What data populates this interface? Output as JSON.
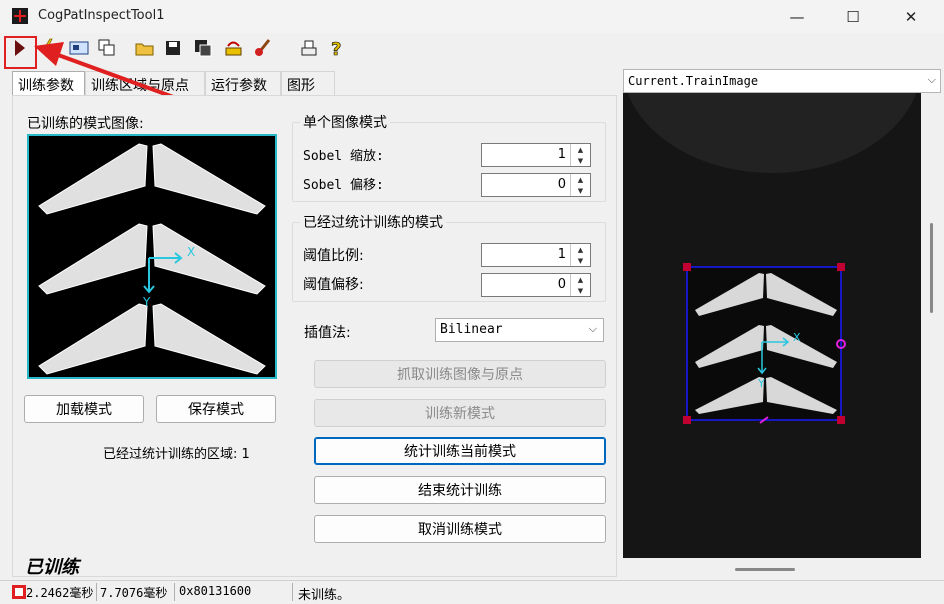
{
  "window": {
    "title": "CogPatInspectTool1",
    "minimize": "—",
    "maximize": "☐",
    "close": "✕"
  },
  "tabs": [
    "训练参数",
    "训练区域与原点",
    "运行参数",
    "图形"
  ],
  "left": {
    "trained_image_label": "已训练的模式图像:",
    "load_button": "加载模式",
    "save_button": "保存模式",
    "stat_regions_label": "已经过统计训练的区域: 1",
    "trained_status": "已训练"
  },
  "single_mode": {
    "title": "单个图像模式",
    "sobel_scale_label": "Sobel 缩放:",
    "sobel_scale_value": "1",
    "sobel_offset_label": "Sobel 偏移:",
    "sobel_offset_value": "0"
  },
  "stat_mode": {
    "title": "已经过统计训练的模式",
    "threshold_scale_label": "阈值比例:",
    "threshold_scale_value": "1",
    "threshold_offset_label": "阈值偏移:",
    "threshold_offset_value": "0"
  },
  "interp": {
    "label": "插值法:",
    "value": "Bilinear"
  },
  "actions": {
    "grab": "抓取训练图像与原点",
    "train_new": "训练新模式",
    "stat_train": "统计训练当前模式",
    "end_stat": "结束统计训练",
    "cancel": "取消训练模式"
  },
  "image_view": {
    "selector": "Current.TrainImage",
    "axis_x": "X",
    "axis_y": "Y"
  },
  "status": {
    "time1": "2.2462毫秒",
    "time2": "7.7076毫秒",
    "code": "0x80131600",
    "message": "未训练。"
  },
  "colors": {
    "accent": "#0067c0",
    "highlight": "#e02020",
    "roi": "#1a1aff",
    "axis": "#28c8e0"
  }
}
